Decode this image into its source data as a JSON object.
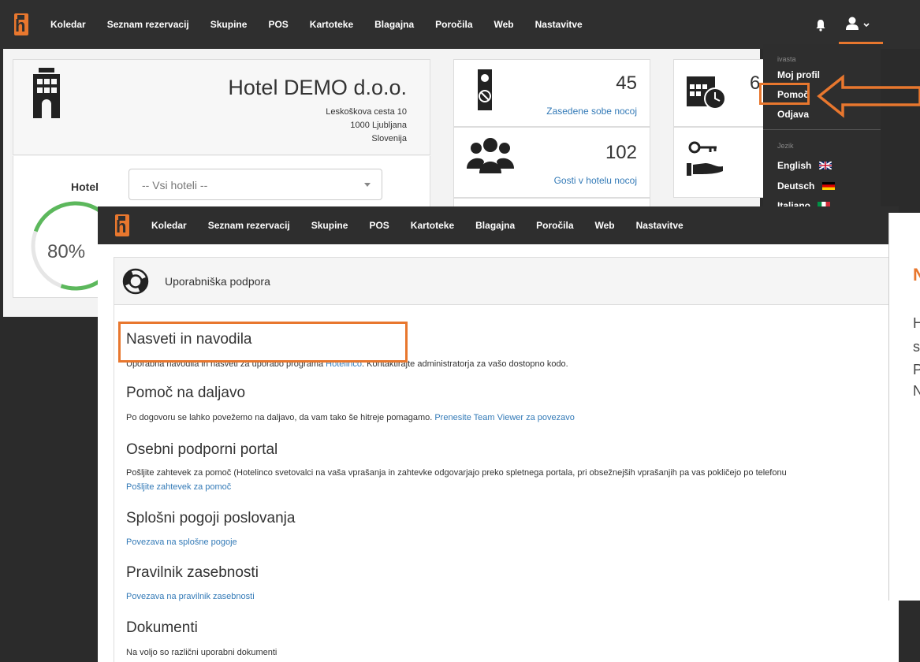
{
  "back_nav": {
    "items": [
      "Koledar",
      "Seznam rezervacij",
      "Skupine",
      "POS",
      "Kartoteke",
      "Blagajna",
      "Poročila",
      "Web",
      "Nastavitve"
    ]
  },
  "hotel": {
    "name": "Hotel DEMO d.o.o.",
    "address_line1": "Leskoškova cesta 10",
    "address_line2": "1000 Ljubljana",
    "address_line3": "Slovenija",
    "filter_label": "Hotel",
    "filter_value": "-- Vsi hoteli --",
    "occupancy": "80%"
  },
  "stats": {
    "rooms_value": "45",
    "rooms_label": "Zasedene sobe nocoj",
    "guests_value": "102",
    "guests_label": "Gosti v hotelu nocoj",
    "partial_value": "6"
  },
  "user_menu": {
    "section_user": "ivasta",
    "items": [
      "Moj profil",
      "Pomoč",
      "Odjava"
    ],
    "section_lang": "Jezik",
    "languages": [
      "English",
      "Deutsch",
      "Italiano"
    ]
  },
  "front_nav": {
    "items": [
      "Koledar",
      "Seznam rezervacij",
      "Skupine",
      "POS",
      "Kartoteke",
      "Blagajna",
      "Poročila",
      "Web",
      "Nastavitve"
    ]
  },
  "support": {
    "title": "Uporabniška podpora",
    "sections": [
      {
        "heading": "Nasveti in navodila",
        "text_before": "Uporabna navodila in nasveti za uporabo programa ",
        "link": "Hotelinco",
        "text_after": ". Kontaktirajte administratorja za vašo dostopno kodo."
      },
      {
        "heading": "Pomoč na daljavo",
        "text_before": "Po dogovoru se lahko povežemo na daljavo, da vam tako še hitreje pomagamo. ",
        "link": "Prenesite Team Viewer za povezavo"
      },
      {
        "heading": "Osebni podporni portal",
        "text_before": "Pošljite zahtevek za pomoč (Hotelinco svetovalci na vaša vprašanja in zahtevke odgovarjajo preko spletnega portala, pri obsežnejših vprašanjih pa vas pokličejo po telefonu",
        "link": "Pošljite zahtevek za pomoč"
      },
      {
        "heading": "Splošni pogoji poslovanja",
        "link": "Povezava na splošne pogoje"
      },
      {
        "heading": "Pravilnik zasebnosti",
        "link": "Povezava na pravilnik zasebnosti"
      },
      {
        "heading": "Dokumenti",
        "text_before": "Na voljo so različni uporabni dokumenti"
      }
    ]
  },
  "side_box": {
    "title": "N",
    "lines": [
      "H",
      "s",
      "P",
      "N"
    ]
  },
  "colors": {
    "accent": "#e8772e",
    "nav_bg": "#2f2f2f",
    "link": "#337ab7"
  }
}
